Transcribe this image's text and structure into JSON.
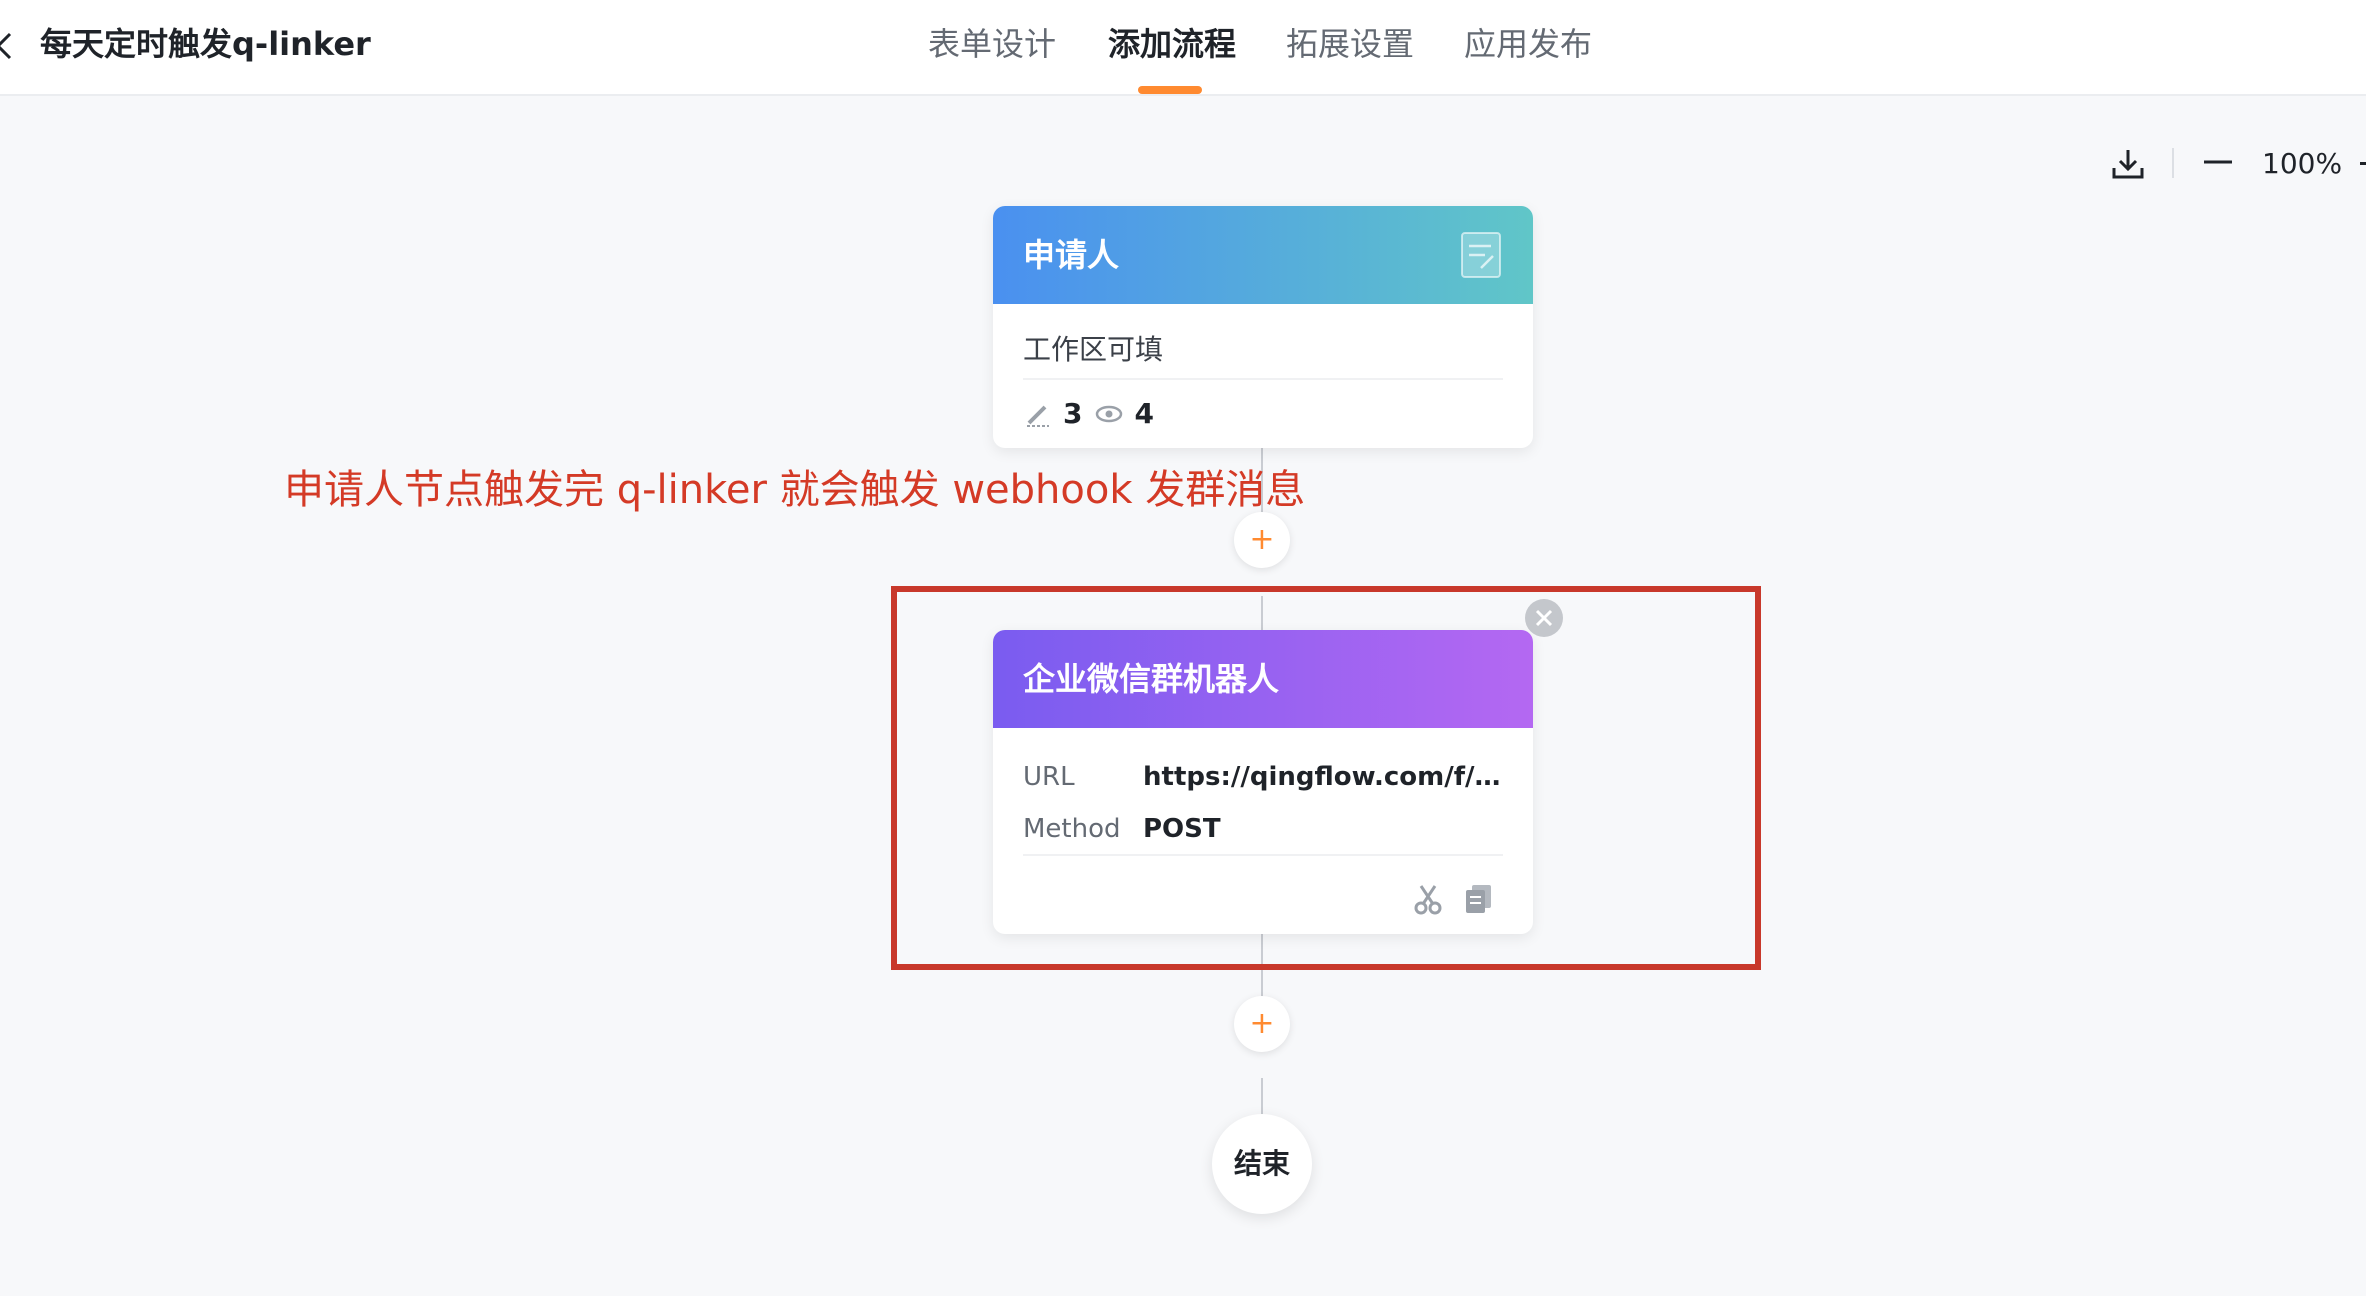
{
  "header": {
    "title": "每天定时触发q-linker",
    "tabs": [
      {
        "label": "表单设计",
        "active": false
      },
      {
        "label": "添加流程",
        "active": true
      },
      {
        "label": "拓展设置",
        "active": false
      },
      {
        "label": "应用发布",
        "active": false
      }
    ]
  },
  "toolbar": {
    "zoom_level": "100%",
    "icons": [
      "download-icon",
      "zoom-out-icon"
    ]
  },
  "flow": {
    "applicant_node": {
      "title": "申请人",
      "description": "工作区可填",
      "editable_count": "3",
      "visible_count": "4"
    },
    "robot_node": {
      "title": "企业微信群机器人",
      "url_label": "URL",
      "url_value": "https://qingflow.com/f/6de...",
      "method_label": "Method",
      "method_value": "POST"
    },
    "add_symbol": "+",
    "end_node_label": "结束"
  },
  "annotation": {
    "text": "申请人节点触发完 q-linker 就会触发 webhook 发群消息",
    "color": "#d43a26",
    "box_color": "#c8382b"
  },
  "colors": {
    "accent": "#ff8a30",
    "applicant_gradient": [
      "#4a90f0",
      "#60c6c8"
    ],
    "robot_gradient": [
      "#7a5cf0",
      "#b468f2"
    ]
  }
}
